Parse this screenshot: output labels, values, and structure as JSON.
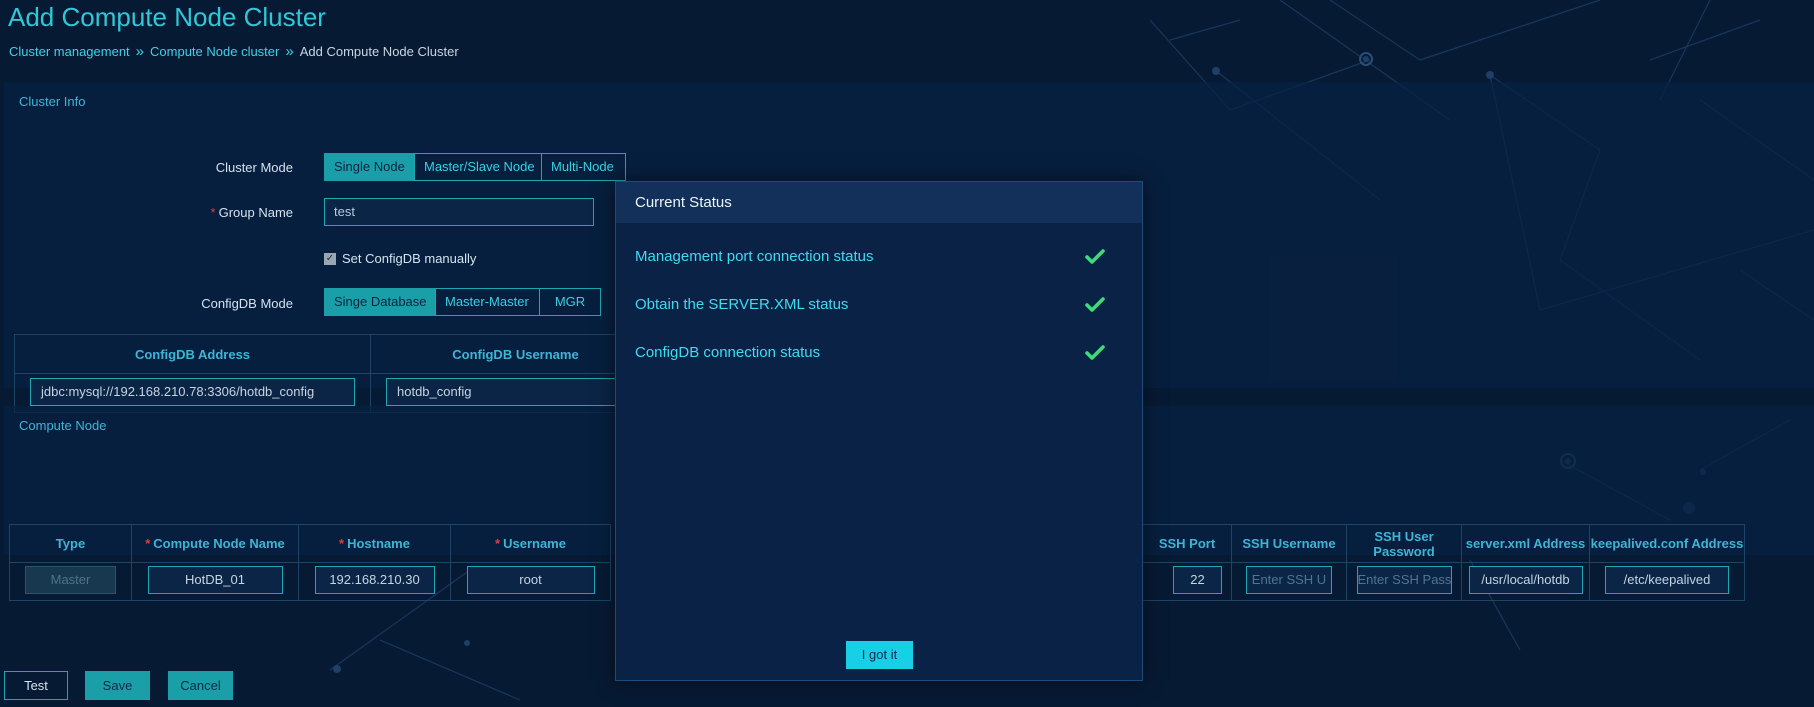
{
  "page": {
    "title": "Add Compute Node Cluster",
    "breadcrumb": [
      "Cluster management",
      "Compute Node cluster",
      "Add Compute Node Cluster"
    ],
    "breadcrumb_sep": "»"
  },
  "cluster_info": {
    "section_title": "Cluster Info",
    "cluster_mode_label": "Cluster Mode",
    "cluster_modes": [
      "Single Node",
      "Master/Slave Node",
      "Multi-Node"
    ],
    "group_name_label": "Group Name",
    "group_name_value": "test",
    "checkbox_label": "Set ConfigDB manually",
    "configdb_mode_label": "ConfigDB Mode",
    "configdb_modes": [
      "Singe Database",
      "Master-Master",
      "MGR"
    ],
    "config_table": {
      "headers": [
        "ConfigDB Address",
        "ConfigDB Username"
      ],
      "values": [
        "jdbc:mysql://192.168.210.78:3306/hotdb_config",
        "hotdb_config"
      ]
    }
  },
  "compute_node": {
    "section_title": "Compute Node",
    "headers_left": [
      "Type",
      "Compute Node Name",
      "Hostname",
      "Username"
    ],
    "headers_right": [
      "SSH Port",
      "SSH Username",
      "SSH User Password",
      "server.xml Address",
      "keepalived.conf Address"
    ],
    "row_left": [
      "Master",
      "HotDB_01",
      "192.168.210.30",
      "root"
    ],
    "row_right": [
      "22",
      "Enter SSH U",
      "Enter SSH Passv",
      "/usr/local/hotdb",
      "/etc/keepalived"
    ]
  },
  "buttons": {
    "test": "Test",
    "save": "Save",
    "cancel": "Cancel"
  },
  "modal": {
    "title": "Current Status",
    "items": [
      "Management port connection status",
      "Obtain the SERVER.XML status",
      "ConfigDB connection status"
    ],
    "confirm": "I got it"
  },
  "colors": {
    "accent": "#1a9fa8",
    "link": "#3fd1e6",
    "check": "#3fd97a",
    "background": "#071a33"
  },
  "icons": {
    "check": "check-icon",
    "checkbox": "checkbox-checked-icon"
  }
}
